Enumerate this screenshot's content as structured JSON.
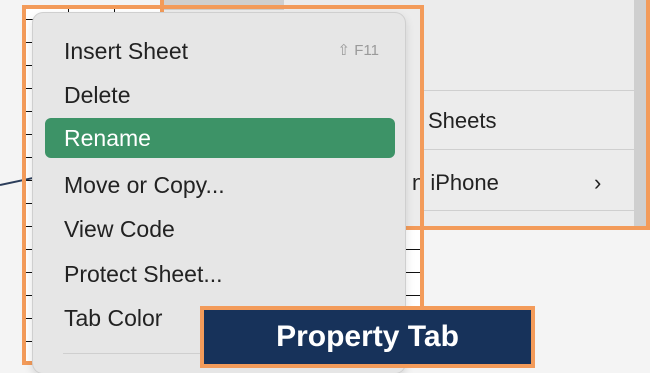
{
  "colors": {
    "highlight": "#3d9367",
    "callout_border": "#f39b5a",
    "label_background": "#17325a"
  },
  "back_menu": {
    "items": [
      {
        "label": "Sheets",
        "icon": ""
      },
      {
        "label": "n iPhone",
        "icon": "chevron-right-icon"
      }
    ],
    "chevron_glyph": "›"
  },
  "context_menu": {
    "items": [
      {
        "label": "Insert Sheet",
        "shortcut_symbol": "⇧",
        "shortcut_key": "F11"
      },
      {
        "label": "Delete"
      },
      {
        "label": "Rename",
        "highlighted": true
      },
      {
        "label": "Move or Copy..."
      },
      {
        "label": "View Code"
      },
      {
        "label": "Protect Sheet..."
      },
      {
        "label": "Tab Color"
      }
    ]
  },
  "callout": {
    "label": "Property Tab"
  }
}
